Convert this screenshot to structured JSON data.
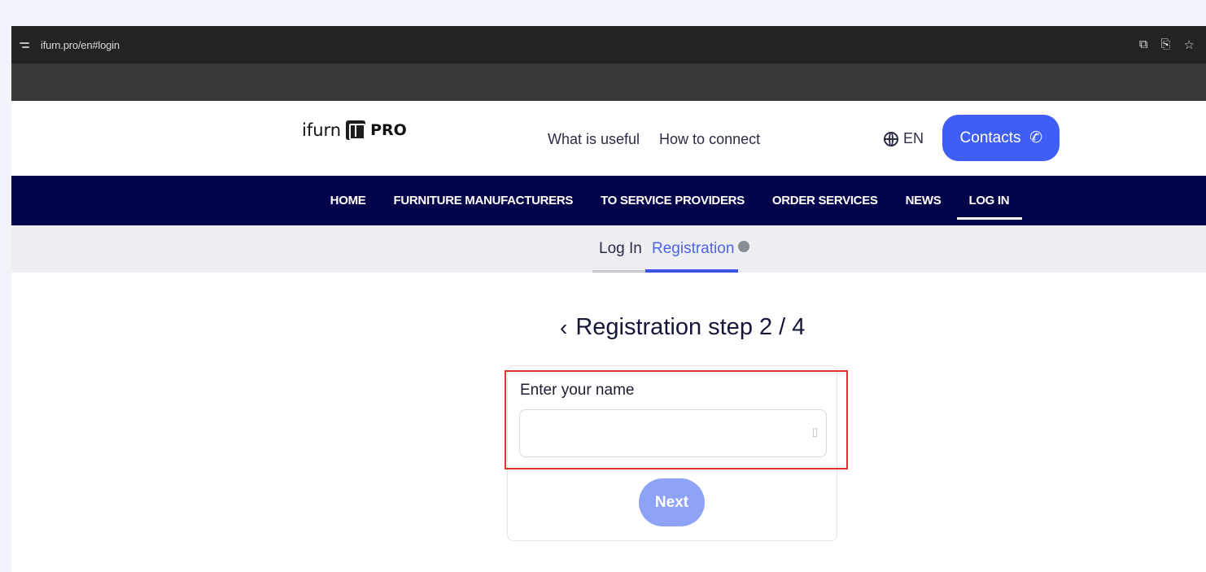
{
  "browser": {
    "url": "ifurn.pro/en#login",
    "icons": [
      "site-settings-icon",
      "cast-icon",
      "translate-icon",
      "bookmark-star-icon"
    ]
  },
  "header": {
    "logo_text": "ifurn",
    "logo_suffix": "PRO",
    "links": [
      "What is useful",
      "How to connect"
    ],
    "language": "EN",
    "contacts_label": "Contacts"
  },
  "nav": {
    "items": [
      "HOME",
      "FURNITURE MANUFACTURERS",
      "TO SERVICE PROVIDERS",
      "ORDER SERVICES",
      "NEWS",
      "LOG IN"
    ],
    "active": "LOG IN"
  },
  "auth_tabs": {
    "login": "Log In",
    "registration": "Registration",
    "active": "Registration"
  },
  "registration": {
    "title": "Registration step 2 / 4",
    "field_label": "Enter your name",
    "field_value": "",
    "next_label": "Next"
  },
  "colors": {
    "accent": "#3f5ef5",
    "nav_bg": "#04044a",
    "highlight": "#e53030"
  }
}
